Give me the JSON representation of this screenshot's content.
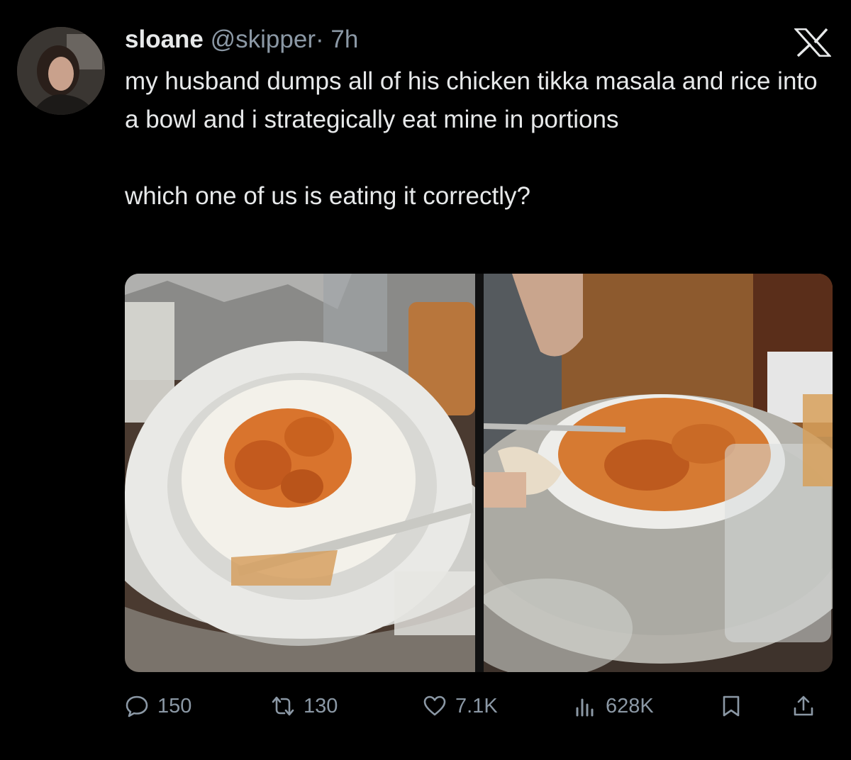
{
  "tweet": {
    "author": {
      "display_name": "sloane",
      "handle": "@skipper",
      "separator": "·",
      "time": "7h",
      "avatar_icon": "profile-photo"
    },
    "platform_icon": "x-logo",
    "text_paragraphs": [
      "my husband dumps all of his chicken tikka masala and rice into a bowl and i strategically eat mine in portions",
      "which one of us is eating it correctly?"
    ],
    "media": [
      {
        "type": "photo",
        "icon": "food-photo"
      },
      {
        "type": "photo",
        "icon": "food-photo"
      }
    ],
    "stats": {
      "replies": "150",
      "reposts": "130",
      "likes": "7.1K",
      "views": "628K"
    }
  },
  "colors": {
    "background": "#000000",
    "text": "#e7e9ea",
    "secondary_text": "#8b98a5"
  }
}
